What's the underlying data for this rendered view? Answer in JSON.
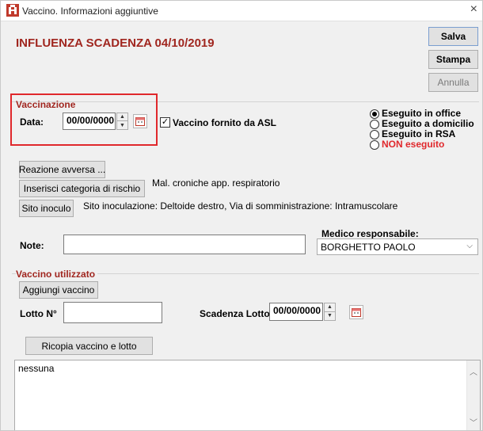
{
  "window": {
    "title": "Vaccino. Informazioni aggiuntive",
    "close": "×"
  },
  "header": {
    "title": "INFLUENZA SCADENZA 04/10/2019"
  },
  "actions": {
    "save": "Salva",
    "print": "Stampa",
    "cancel": "Annulla"
  },
  "vaccinazione": {
    "title": "Vaccinazione",
    "date_label": "Data:",
    "date_value": "00/00/0000",
    "asl_checkbox_label": "Vaccino fornito da ASL",
    "asl_checked": true
  },
  "execution": {
    "options": [
      {
        "label": "Eseguito in office",
        "checked": true,
        "color": "#000000"
      },
      {
        "label": "Eseguito a domicilio",
        "checked": false,
        "color": "#000000"
      },
      {
        "label": "Eseguito in RSA",
        "checked": false,
        "color": "#000000"
      },
      {
        "label": "NON eseguito",
        "checked": false,
        "color": "#e0282c"
      }
    ]
  },
  "buttons": {
    "adverse_reaction": "Reazione avversa ...",
    "risk_category": "Inserisci categoria di rischio",
    "injection_site": "Sito inoculo"
  },
  "info": {
    "risk_category_value": "Mal. croniche app. respiratorio",
    "injection_site_value": "Sito inoculazione: Deltoide destro, Via di somministrazione: Intramuscolare"
  },
  "notes": {
    "label": "Note:",
    "value": ""
  },
  "doctor": {
    "label": "Medico responsabile:",
    "value": "BORGHETTO PAOLO"
  },
  "vaccine_used": {
    "title": "Vaccino utilizzato",
    "add_button": "Aggiungi vaccino",
    "lot_label": "Lotto N°",
    "lot_value": "",
    "lot_expiry_label": "Scadenza Lotto:",
    "lot_expiry_value": "00/00/0000",
    "copy_button": "Ricopia vaccino e lotto"
  },
  "bottom_text": {
    "value": "nessuna"
  },
  "icons": {
    "spin_up": "▲",
    "spin_down": "▼",
    "scroll_up": "︿",
    "scroll_down": "﹀",
    "dropdown": "⌵",
    "check": "✓"
  }
}
